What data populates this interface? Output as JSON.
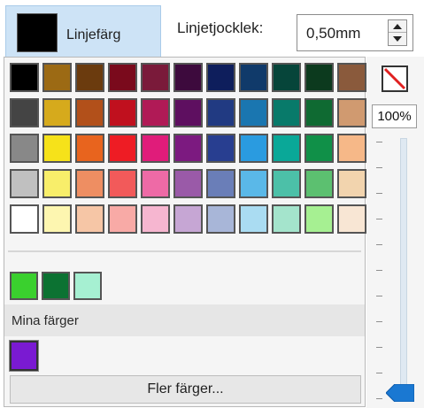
{
  "line_color_tab": {
    "label": "Linjefärg",
    "swatch_color": "#000000"
  },
  "line_width": {
    "label": "Linjetjocklek:",
    "value": "0,50mm"
  },
  "palette": {
    "rows": [
      [
        "#000000",
        "#9c6a14",
        "#6b3b0e",
        "#7a0a1c",
        "#7a1a3a",
        "#3d0a3d",
        "#0e1e5c",
        "#103a6a",
        "#06453a",
        "#0c3a1e",
        "#8a5a3c"
      ],
      [
        "#444444",
        "#d6aa1c",
        "#b2501a",
        "#c0101e",
        "#b01a56",
        "#5e0f60",
        "#213a82",
        "#1a76b0",
        "#087a6a",
        "#0f6a32",
        "#d09a70"
      ],
      [
        "#888888",
        "#f6e21a",
        "#e8641e",
        "#ee1c24",
        "#e01c7a",
        "#7c1a80",
        "#283e90",
        "#2a9be0",
        "#0aa898",
        "#109048",
        "#f6b888"
      ],
      [
        "#c0c0c0",
        "#f8ee6a",
        "#ee8e62",
        "#f25a5a",
        "#ee6aa6",
        "#9a5aa8",
        "#6a7eb8",
        "#5ab8e8",
        "#4cc0a8",
        "#5cc070",
        "#f2d4ae"
      ],
      [
        "#ffffff",
        "#fdf6b0",
        "#f6c6a6",
        "#f8aaa6",
        "#f6b6d0",
        "#c6a6d4",
        "#a8b6d8",
        "#aadcf2",
        "#a4e4cc",
        "#a6f092",
        "#f8e6d4"
      ]
    ]
  },
  "recent_colors": [
    "#3ad02e",
    "#0c7232",
    "#a6f0d2"
  ],
  "my_colors": {
    "label": "Mina färger",
    "custom_swatch": "#7a1ad2"
  },
  "more_colors_button": {
    "label": "Fler färger..."
  },
  "transparency": {
    "value_label": "100%"
  }
}
